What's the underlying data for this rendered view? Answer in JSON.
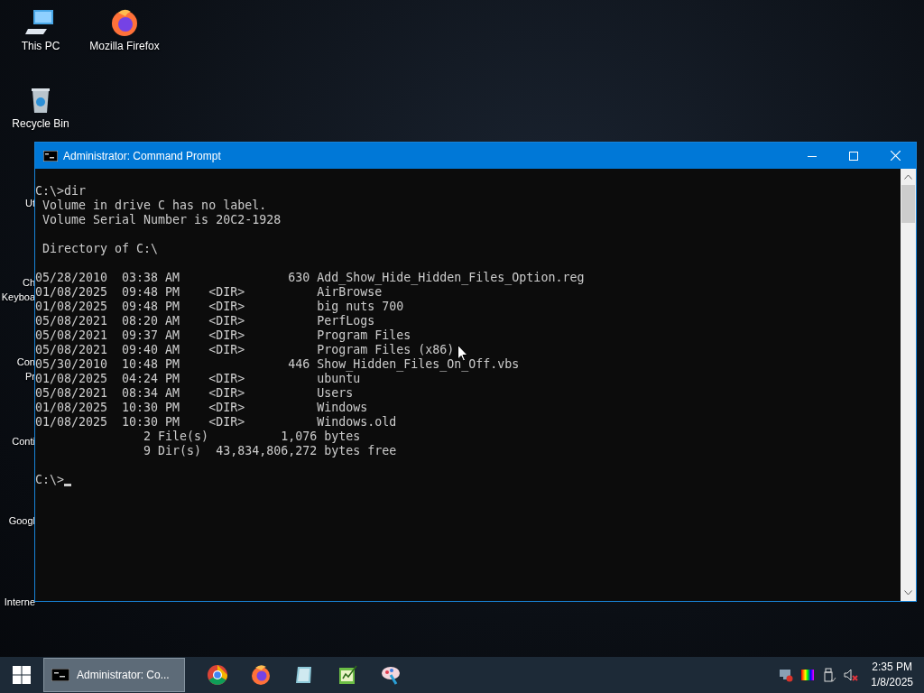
{
  "desktop_icons": [
    {
      "label": "This PC",
      "kind": "pc"
    },
    {
      "label": "Mozilla Firefox",
      "kind": "firefox"
    },
    {
      "label": "Recycle Bin",
      "kind": "bin"
    }
  ],
  "covered_icon_labels": [
    {
      "lines": [
        "Ut"
      ]
    },
    {
      "lines": [
        "Ch",
        "Keyboa"
      ]
    },
    {
      "lines": [
        "Con",
        "Pr"
      ]
    },
    {
      "lines": [
        "Conti"
      ]
    },
    {
      "lines": [
        "Googl"
      ]
    },
    {
      "lines": [
        "Interne"
      ]
    }
  ],
  "window": {
    "title": "Administrator: Command Prompt"
  },
  "console": {
    "blocks": [
      [
        "C:\\>dir",
        " Volume in drive C has no label.",
        " Volume Serial Number is 20C2-1928"
      ],
      [
        " Directory of C:\\"
      ],
      [
        "05/28/2010  03:38 AM               630 Add_Show_Hide_Hidden_Files_Option.reg",
        "01/08/2025  09:48 PM    <DIR>          AirBrowse",
        "01/08/2025  09:48 PM    <DIR>          big nuts 700",
        "05/08/2021  08:20 AM    <DIR>          PerfLogs",
        "05/08/2021  09:37 AM    <DIR>          Program Files",
        "05/08/2021  09:40 AM    <DIR>          Program Files (x86)",
        "05/30/2010  10:48 PM               446 Show_Hidden_Files_On_Off.vbs",
        "01/08/2025  04:24 PM    <DIR>          ubuntu",
        "05/08/2021  08:34 AM    <DIR>          Users",
        "01/08/2025  10:30 PM    <DIR>          Windows",
        "01/08/2025  10:30 PM    <DIR>          Windows.old",
        "               2 File(s)          1,076 bytes",
        "               9 Dir(s)  43,834,806,272 bytes free"
      ],
      [
        "C:\\>"
      ]
    ],
    "cursor": true
  },
  "taskbar": {
    "task": {
      "label": "Administrator: Co...",
      "selected": true
    },
    "pinned": [
      {
        "kind": "chrome"
      },
      {
        "kind": "firefox"
      },
      {
        "kind": "notepad"
      },
      {
        "kind": "chart"
      },
      {
        "kind": "paint"
      }
    ],
    "tray": [
      {
        "kind": "network"
      },
      {
        "kind": "color"
      },
      {
        "kind": "usb"
      },
      {
        "kind": "volume"
      }
    ],
    "time": "2:35 PM",
    "date": "1/8/2025"
  }
}
